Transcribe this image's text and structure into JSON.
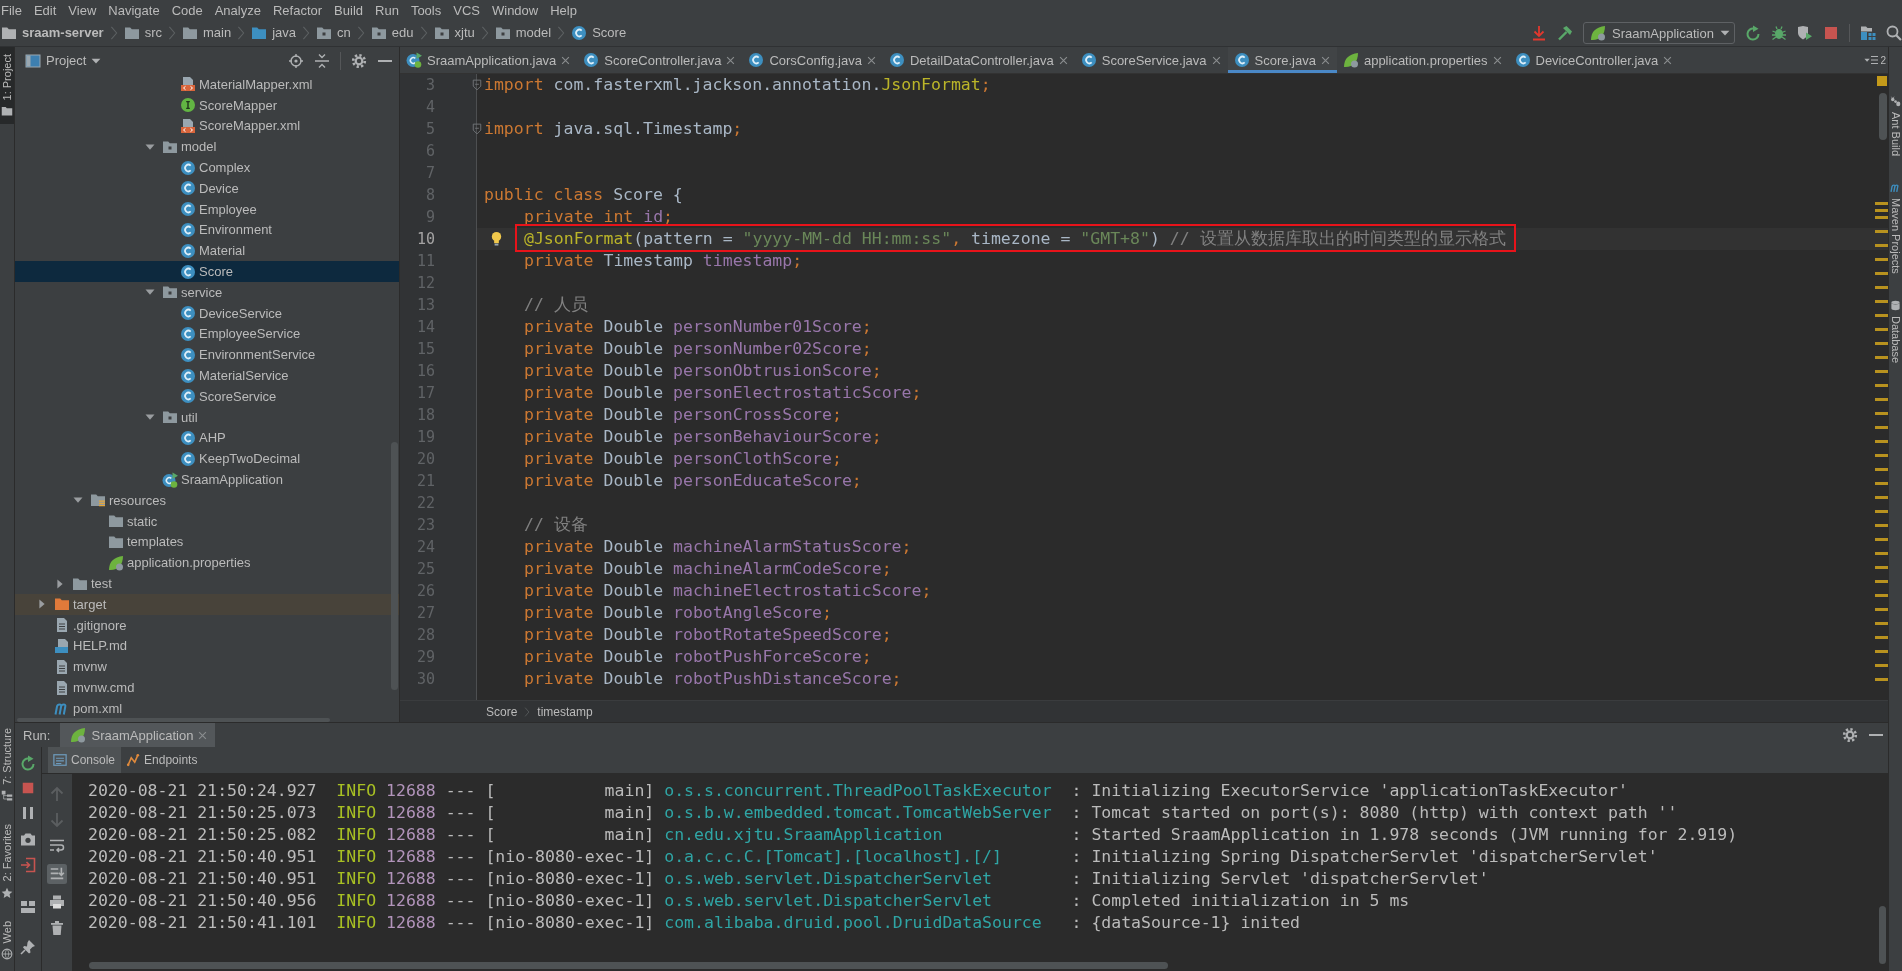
{
  "menu_bar": [
    "File",
    "Edit",
    "View",
    "Navigate",
    "Code",
    "Analyze",
    "Refactor",
    "Build",
    "Run",
    "Tools",
    "VCS",
    "Window",
    "Help"
  ],
  "navigation_bar": {
    "breadcrumbs": [
      {
        "label": "sraam-server",
        "kind": "project"
      },
      {
        "label": "src",
        "kind": "folder"
      },
      {
        "label": "main",
        "kind": "folder"
      },
      {
        "label": "java",
        "kind": "source-folder"
      },
      {
        "label": "cn",
        "kind": "package"
      },
      {
        "label": "edu",
        "kind": "package"
      },
      {
        "label": "xjtu",
        "kind": "package"
      },
      {
        "label": "model",
        "kind": "package"
      },
      {
        "label": "Score",
        "kind": "class"
      }
    ],
    "run_configuration": "SraamApplication"
  },
  "left_strip": {
    "top": [
      {
        "label": "1: Project",
        "kind": "project",
        "selected": true
      }
    ],
    "bottom": [
      {
        "label": "7: Structure",
        "kind": "structure",
        "selected": false
      },
      {
        "label": "2: Favorites",
        "kind": "favorites",
        "selected": false
      },
      {
        "label": "Web",
        "kind": "web",
        "selected": false
      }
    ]
  },
  "right_strip": [
    {
      "label": "Ant Build",
      "kind": "ant",
      "selected": false
    },
    {
      "label": "Maven Projects",
      "kind": "maven",
      "selected": false
    },
    {
      "label": "Database",
      "kind": "database",
      "selected": false
    }
  ],
  "project_panel": {
    "title": "Project",
    "tree": [
      {
        "children": [
          {
            "children": [
              {
                "children": [
                  {
                    "children": [
                      {
                        "children": [
                          {
                            "children": [
                              {
                                "children": [
                                  {
                                    "label": "MaterialMapper.xml",
                                    "kind": "xml",
                                    "selected": false
                                  },
                                  {
                                    "label": "ScoreMapper",
                                    "kind": "interface",
                                    "selected": false
                                  },
                                  {
                                    "label": "ScoreMapper.xml",
                                    "kind": "xml",
                                    "selected": false
                                  }
                                ]
                              },
                              {
                                "label": "model",
                                "kind": "package",
                                "expanded": true,
                                "selected": false,
                                "children": [
                                  {
                                    "label": "Complex",
                                    "kind": "class",
                                    "selected": false
                                  },
                                  {
                                    "label": "Device",
                                    "kind": "class",
                                    "selected": false
                                  },
                                  {
                                    "label": "Employee",
                                    "kind": "class",
                                    "selected": false
                                  },
                                  {
                                    "label": "Environment",
                                    "kind": "class",
                                    "selected": false
                                  },
                                  {
                                    "label": "Material",
                                    "kind": "class",
                                    "selected": false
                                  },
                                  {
                                    "label": "Score",
                                    "kind": "class",
                                    "selected": true
                                  }
                                ]
                              },
                              {
                                "label": "service",
                                "kind": "package",
                                "expanded": true,
                                "selected": false,
                                "children": [
                                  {
                                    "label": "DeviceService",
                                    "kind": "class",
                                    "selected": false
                                  },
                                  {
                                    "label": "EmployeeService",
                                    "kind": "class",
                                    "selected": false
                                  },
                                  {
                                    "label": "EnvironmentService",
                                    "kind": "class",
                                    "selected": false
                                  },
                                  {
                                    "label": "MaterialService",
                                    "kind": "class",
                                    "selected": false
                                  },
                                  {
                                    "label": "ScoreService",
                                    "kind": "class",
                                    "selected": false
                                  }
                                ]
                              },
                              {
                                "label": "util",
                                "kind": "package",
                                "expanded": true,
                                "selected": false,
                                "children": [
                                  {
                                    "label": "AHP",
                                    "kind": "class",
                                    "selected": false
                                  },
                                  {
                                    "label": "KeepTwoDecimal",
                                    "kind": "class",
                                    "selected": false
                                  }
                                ]
                              },
                              {
                                "label": "SraamApplication",
                                "kind": "spring-app",
                                "selected": false
                              }
                            ]
                          }
                        ]
                      }
                    ]
                  }
                ]
              },
              {
                "label": "resources",
                "kind": "resources-folder",
                "expanded": true,
                "selected": false,
                "children": [
                  {
                    "label": "static",
                    "kind": "folder",
                    "selected": false
                  },
                  {
                    "label": "templates",
                    "kind": "folder",
                    "selected": false
                  },
                  {
                    "label": "application.properties",
                    "kind": "properties",
                    "selected": false
                  }
                ]
              }
            ]
          },
          {
            "label": "test",
            "kind": "folder",
            "expanded": false,
            "selected": false
          }
        ]
      },
      {
        "label": "target",
        "kind": "excluded-folder",
        "expanded": false,
        "selected": false
      },
      {
        "label": ".gitignore",
        "kind": "text-file",
        "selected": false
      },
      {
        "label": "HELP.md",
        "kind": "markdown",
        "selected": false
      },
      {
        "label": "mvnw",
        "kind": "text-file",
        "selected": false
      },
      {
        "label": "mvnw.cmd",
        "kind": "text-file",
        "selected": false
      },
      {
        "label": "pom.xml",
        "kind": "maven",
        "selected": false
      }
    ]
  },
  "editor": {
    "tabs": [
      {
        "label": "SraamApplication.java",
        "kind": "spring-app",
        "selected": false
      },
      {
        "label": "ScoreController.java",
        "kind": "class",
        "selected": false
      },
      {
        "label": "CorsConfig.java",
        "kind": "class",
        "selected": false
      },
      {
        "label": "DetailDataController.java",
        "kind": "class",
        "selected": false
      },
      {
        "label": "ScoreService.java",
        "kind": "class",
        "selected": false
      },
      {
        "label": "Score.java",
        "kind": "class",
        "selected": true
      },
      {
        "label": "application.properties",
        "kind": "properties",
        "selected": false
      },
      {
        "label": "DeviceController.java",
        "kind": "class",
        "selected": false
      }
    ],
    "hidden_tab_count": "2",
    "lines": [
      {
        "number": "3",
        "indented": false,
        "fold_marker": true,
        "caret_line": false,
        "intention_bulb": false,
        "framed": false,
        "tokens": [
          {
            "kind": "keyword",
            "text": "import"
          },
          {
            "kind": "plain",
            "text": " com.fasterxml.jackson.annotation."
          },
          {
            "kind": "annotation",
            "text": "JsonFormat"
          },
          {
            "kind": "keyword",
            "text": ";"
          }
        ]
      },
      {
        "number": "4",
        "fold_marker": false,
        "caret_line": false,
        "intention_bulb": false,
        "framed": false
      },
      {
        "number": "5",
        "indented": false,
        "fold_marker": true,
        "caret_line": false,
        "intention_bulb": false,
        "framed": false,
        "tokens": [
          {
            "kind": "keyword",
            "text": "import"
          },
          {
            "kind": "plain",
            "text": " java.sql.Timestamp"
          },
          {
            "kind": "keyword",
            "text": ";"
          }
        ]
      },
      {
        "number": "6",
        "fold_marker": false,
        "caret_line": false,
        "intention_bulb": false,
        "framed": false
      },
      {
        "number": "7",
        "fold_marker": false,
        "caret_line": false,
        "intention_bulb": false,
        "framed": false
      },
      {
        "number": "8",
        "indented": false,
        "fold_marker": false,
        "caret_line": false,
        "intention_bulb": false,
        "framed": false,
        "tokens": [
          {
            "kind": "keyword",
            "text": "public class"
          },
          {
            "kind": "plain",
            "text": " Score {"
          }
        ]
      },
      {
        "number": "9",
        "indented": true,
        "fold_marker": false,
        "caret_line": false,
        "intention_bulb": false,
        "framed": false,
        "tokens": [
          {
            "kind": "keyword",
            "text": "private int"
          },
          {
            "kind": "field",
            "text": " id"
          },
          {
            "kind": "keyword",
            "text": ";"
          }
        ]
      },
      {
        "number": "10",
        "indented": true,
        "fold_marker": false,
        "caret_line": true,
        "intention_bulb": true,
        "framed": true,
        "tokens": [
          {
            "kind": "annotation",
            "text": "@JsonFormat"
          },
          {
            "kind": "plain",
            "text": "(pattern = "
          },
          {
            "kind": "string",
            "text": "\"yyyy-MM-dd HH:mm:ss\""
          },
          {
            "kind": "keyword",
            "text": ","
          },
          {
            "kind": "plain",
            "text": " timezone = "
          },
          {
            "kind": "string",
            "text": "\"GMT+8\""
          },
          {
            "kind": "plain",
            "text": ")"
          },
          {
            "kind": "comment",
            "text": " // 设置从数据库取出的时间类型的显示格式"
          }
        ]
      },
      {
        "number": "11",
        "indented": true,
        "fold_marker": false,
        "caret_line": false,
        "intention_bulb": false,
        "framed": false,
        "tokens": [
          {
            "kind": "keyword",
            "text": "private"
          },
          {
            "kind": "plain",
            "text": " Timestamp "
          },
          {
            "kind": "field",
            "text": "timestamp"
          },
          {
            "kind": "keyword",
            "text": ";"
          }
        ]
      },
      {
        "number": "12",
        "fold_marker": false,
        "caret_line": false,
        "intention_bulb": false,
        "framed": false
      },
      {
        "number": "13",
        "indented": true,
        "fold_marker": false,
        "caret_line": false,
        "intention_bulb": false,
        "framed": false,
        "tokens": [
          {
            "kind": "comment",
            "text": "// 人员"
          }
        ]
      },
      {
        "number": "14",
        "indented": true,
        "fold_marker": false,
        "caret_line": false,
        "intention_bulb": false,
        "framed": false,
        "tokens": [
          {
            "kind": "keyword",
            "text": "private"
          },
          {
            "kind": "plain",
            "text": " Double "
          },
          {
            "kind": "field",
            "text": "personNumber01Score"
          },
          {
            "kind": "keyword",
            "text": ";"
          }
        ]
      },
      {
        "number": "15",
        "indented": true,
        "fold_marker": false,
        "caret_line": false,
        "intention_bulb": false,
        "framed": false,
        "tokens": [
          {
            "kind": "keyword",
            "text": "private"
          },
          {
            "kind": "plain",
            "text": " Double "
          },
          {
            "kind": "field",
            "text": "personNumber02Score"
          },
          {
            "kind": "keyword",
            "text": ";"
          }
        ]
      },
      {
        "number": "16",
        "indented": true,
        "fold_marker": false,
        "caret_line": false,
        "intention_bulb": false,
        "framed": false,
        "tokens": [
          {
            "kind": "keyword",
            "text": "private"
          },
          {
            "kind": "plain",
            "text": " Double "
          },
          {
            "kind": "field",
            "text": "personObtrusionScore"
          },
          {
            "kind": "keyword",
            "text": ";"
          }
        ]
      },
      {
        "number": "17",
        "indented": true,
        "fold_marker": false,
        "caret_line": false,
        "intention_bulb": false,
        "framed": false,
        "tokens": [
          {
            "kind": "keyword",
            "text": "private"
          },
          {
            "kind": "plain",
            "text": " Double "
          },
          {
            "kind": "field",
            "text": "personElectrostaticScore"
          },
          {
            "kind": "keyword",
            "text": ";"
          }
        ]
      },
      {
        "number": "18",
        "indented": true,
        "fold_marker": false,
        "caret_line": false,
        "intention_bulb": false,
        "framed": false,
        "tokens": [
          {
            "kind": "keyword",
            "text": "private"
          },
          {
            "kind": "plain",
            "text": " Double "
          },
          {
            "kind": "field",
            "text": "personCrossScore"
          },
          {
            "kind": "keyword",
            "text": ";"
          }
        ]
      },
      {
        "number": "19",
        "indented": true,
        "fold_marker": false,
        "caret_line": false,
        "intention_bulb": false,
        "framed": false,
        "tokens": [
          {
            "kind": "keyword",
            "text": "private"
          },
          {
            "kind": "plain",
            "text": " Double "
          },
          {
            "kind": "field",
            "text": "personBehaviourScore"
          },
          {
            "kind": "keyword",
            "text": ";"
          }
        ]
      },
      {
        "number": "20",
        "indented": true,
        "fold_marker": false,
        "caret_line": false,
        "intention_bulb": false,
        "framed": false,
        "tokens": [
          {
            "kind": "keyword",
            "text": "private"
          },
          {
            "kind": "plain",
            "text": " Double "
          },
          {
            "kind": "field",
            "text": "personClothScore"
          },
          {
            "kind": "keyword",
            "text": ";"
          }
        ]
      },
      {
        "number": "21",
        "indented": true,
        "fold_marker": false,
        "caret_line": false,
        "intention_bulb": false,
        "framed": false,
        "tokens": [
          {
            "kind": "keyword",
            "text": "private"
          },
          {
            "kind": "plain",
            "text": " Double "
          },
          {
            "kind": "field",
            "text": "personEducateScore"
          },
          {
            "kind": "keyword",
            "text": ";"
          }
        ]
      },
      {
        "number": "22",
        "fold_marker": false,
        "caret_line": false,
        "intention_bulb": false,
        "framed": false
      },
      {
        "number": "23",
        "indented": true,
        "fold_marker": false,
        "caret_line": false,
        "intention_bulb": false,
        "framed": false,
        "tokens": [
          {
            "kind": "comment",
            "text": "// 设备"
          }
        ]
      },
      {
        "number": "24",
        "indented": true,
        "fold_marker": false,
        "caret_line": false,
        "intention_bulb": false,
        "framed": false,
        "tokens": [
          {
            "kind": "keyword",
            "text": "private"
          },
          {
            "kind": "plain",
            "text": " Double "
          },
          {
            "kind": "field",
            "text": "machineAlarmStatusScore"
          },
          {
            "kind": "keyword",
            "text": ";"
          }
        ]
      },
      {
        "number": "25",
        "indented": true,
        "fold_marker": false,
        "caret_line": false,
        "intention_bulb": false,
        "framed": false,
        "tokens": [
          {
            "kind": "keyword",
            "text": "private"
          },
          {
            "kind": "plain",
            "text": " Double "
          },
          {
            "kind": "field",
            "text": "machineAlarmCodeScore"
          },
          {
            "kind": "keyword",
            "text": ";"
          }
        ]
      },
      {
        "number": "26",
        "indented": true,
        "fold_marker": false,
        "caret_line": false,
        "intention_bulb": false,
        "framed": false,
        "tokens": [
          {
            "kind": "keyword",
            "text": "private"
          },
          {
            "kind": "plain",
            "text": " Double "
          },
          {
            "kind": "field",
            "text": "machineElectrostaticScore"
          },
          {
            "kind": "keyword",
            "text": ";"
          }
        ]
      },
      {
        "number": "27",
        "indented": true,
        "fold_marker": false,
        "caret_line": false,
        "intention_bulb": false,
        "framed": false,
        "tokens": [
          {
            "kind": "keyword",
            "text": "private"
          },
          {
            "kind": "plain",
            "text": " Double "
          },
          {
            "kind": "field",
            "text": "robotAngleScore"
          },
          {
            "kind": "keyword",
            "text": ";"
          }
        ]
      },
      {
        "number": "28",
        "indented": true,
        "fold_marker": false,
        "caret_line": false,
        "intention_bulb": false,
        "framed": false,
        "tokens": [
          {
            "kind": "keyword",
            "text": "private"
          },
          {
            "kind": "plain",
            "text": " Double "
          },
          {
            "kind": "field",
            "text": "robotRotateSpeedScore"
          },
          {
            "kind": "keyword",
            "text": ";"
          }
        ]
      },
      {
        "number": "29",
        "indented": true,
        "fold_marker": false,
        "caret_line": false,
        "intention_bulb": false,
        "framed": false,
        "tokens": [
          {
            "kind": "keyword",
            "text": "private"
          },
          {
            "kind": "plain",
            "text": " Double "
          },
          {
            "kind": "field",
            "text": "robotPushForceScore"
          },
          {
            "kind": "keyword",
            "text": ";"
          }
        ]
      },
      {
        "number": "30",
        "indented": true,
        "fold_marker": false,
        "caret_line": false,
        "intention_bulb": false,
        "framed": false,
        "tokens": [
          {
            "kind": "keyword",
            "text": "private"
          },
          {
            "kind": "plain",
            "text": " Double "
          },
          {
            "kind": "field",
            "text": "robotPushDistanceScore"
          },
          {
            "kind": "keyword",
            "text": ";"
          }
        ]
      }
    ],
    "breadcrumbs": [
      "Score",
      "timestamp"
    ]
  },
  "run_panel": {
    "title": "Run:",
    "tabs": [
      {
        "label": "SraamApplication",
        "kind": "spring-boot",
        "selected": true
      }
    ],
    "views": [
      {
        "label": "Console",
        "kind": "console",
        "selected": true
      },
      {
        "label": "Endpoints",
        "kind": "endpoints",
        "selected": false
      }
    ],
    "navigation_enabled": false,
    "scroll_to_end": true,
    "console": [
      {
        "time": "2020-08-21 21:50:24.927",
        "level": "INFO",
        "pid": "12688",
        "separator": "---",
        "thread": "[           main]",
        "logger": "o.s.s.concurrent.ThreadPoolTaskExecutor",
        "message": ": Initializing ExecutorService 'applicationTaskExecutor'"
      },
      {
        "time": "2020-08-21 21:50:25.073",
        "level": "INFO",
        "pid": "12688",
        "separator": "---",
        "thread": "[           main]",
        "logger": "o.s.b.w.embedded.tomcat.TomcatWebServer",
        "message": ": Tomcat started on port(s): 8080 (http) with context path ''"
      },
      {
        "time": "2020-08-21 21:50:25.082",
        "level": "INFO",
        "pid": "12688",
        "separator": "---",
        "thread": "[           main]",
        "logger": "cn.edu.xjtu.SraamApplication",
        "message": ": Started SraamApplication in 1.978 seconds (JVM running for 2.919)"
      },
      {
        "time": "2020-08-21 21:50:40.951",
        "level": "INFO",
        "pid": "12688",
        "separator": "---",
        "thread": "[nio-8080-exec-1]",
        "logger": "o.a.c.c.C.[Tomcat].[localhost].[/]",
        "message": ": Initializing Spring DispatcherServlet 'dispatcherServlet'"
      },
      {
        "time": "2020-08-21 21:50:40.951",
        "level": "INFO",
        "pid": "12688",
        "separator": "---",
        "thread": "[nio-8080-exec-1]",
        "logger": "o.s.web.servlet.DispatcherServlet",
        "message": ": Initializing Servlet 'dispatcherServlet'"
      },
      {
        "time": "2020-08-21 21:50:40.956",
        "level": "INFO",
        "pid": "12688",
        "separator": "---",
        "thread": "[nio-8080-exec-1]",
        "logger": "o.s.web.servlet.DispatcherServlet",
        "message": ": Completed initialization in 5 ms"
      },
      {
        "time": "2020-08-21 21:50:41.101",
        "level": "INFO",
        "pid": "12688",
        "separator": "---",
        "thread": "[nio-8080-exec-1]",
        "logger": "com.alibaba.druid.pool.DruidDataSource",
        "message": ": {dataSource-1} inited"
      }
    ]
  }
}
